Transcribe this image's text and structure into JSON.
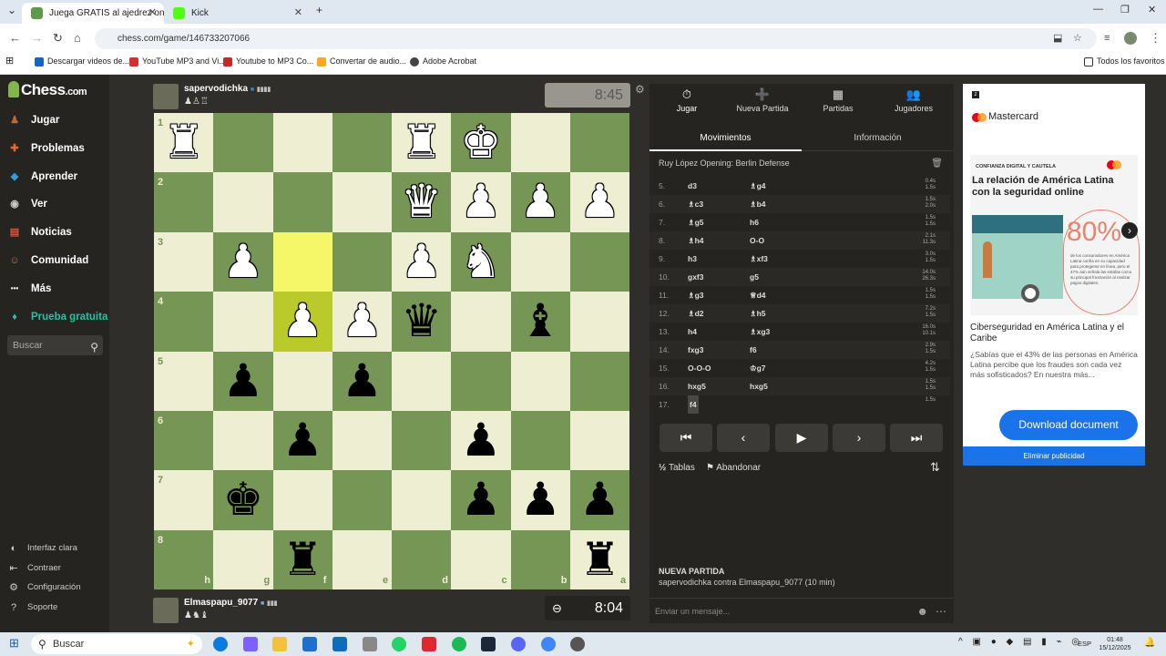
{
  "browser": {
    "tabs": [
      {
        "title": "Juega GRATIS al ajedrez online -",
        "favicon_color": "#5d9948"
      },
      {
        "title": "Kick",
        "favicon_color": "#53fc18"
      }
    ],
    "url": "chess.com/game/146733207066",
    "bookmarks": [
      {
        "label": "Descargar videos de...",
        "color": "#1565c0"
      },
      {
        "label": "YouTube MP3 and Vi...",
        "color": "#d32f2f"
      },
      {
        "label": "Youtube to MP3 Co...",
        "color": "#c62828"
      },
      {
        "label": "Convertar de audio...",
        "color": "#f9a825"
      },
      {
        "label": "Adobe Acrobat",
        "color": "#444444"
      }
    ],
    "all_bookmarks_label": "Todos los favoritos"
  },
  "sidebar": {
    "logo": "Chess",
    "logo_suffix": ".com",
    "items": [
      {
        "label": "Jugar",
        "icon": "play-icon",
        "color": "#ba6a37"
      },
      {
        "label": "Problemas",
        "icon": "puzzle-icon",
        "color": "#e9662c"
      },
      {
        "label": "Aprender",
        "icon": "learn-icon",
        "color": "#2f9ed4"
      },
      {
        "label": "Ver",
        "icon": "watch-icon",
        "color": "#c8c8c8"
      },
      {
        "label": "Noticias",
        "icon": "news-icon",
        "color": "#e6503b"
      },
      {
        "label": "Comunidad",
        "icon": "community-icon",
        "color": "#b07d5a"
      },
      {
        "label": "Más",
        "icon": "more-icon",
        "color": "#ffffff"
      },
      {
        "label": "Prueba gratuita",
        "icon": "diamond-icon",
        "color": "#26c2a3"
      }
    ],
    "search_placeholder": "Buscar",
    "footer": [
      {
        "label": "Interfaz clara",
        "icon": "theme-icon"
      },
      {
        "label": "Contraer",
        "icon": "collapse-icon"
      },
      {
        "label": "Configuración",
        "icon": "settings-icon"
      },
      {
        "label": "Soporte",
        "icon": "help-icon"
      }
    ]
  },
  "top_player": {
    "name": "sapervodichka",
    "clock": "8:45"
  },
  "bottom_player": {
    "name": "Elmaspapu_9077",
    "clock": "8:04"
  },
  "board": {
    "light": "#eeeed2",
    "dark": "#769656",
    "rank_labels": [
      "1",
      "2",
      "3",
      "4",
      "5",
      "6",
      "7",
      "8"
    ],
    "file_labels": [
      "h",
      "g",
      "f",
      "e",
      "d",
      "c",
      "b",
      "a"
    ],
    "highlighted": [
      "f3",
      "f4"
    ],
    "pieces": [
      {
        "sq": "h1",
        "glyph": "♜",
        "color": "w"
      },
      {
        "sq": "d1",
        "glyph": "♜",
        "color": "w"
      },
      {
        "sq": "c1",
        "glyph": "♚",
        "color": "w"
      },
      {
        "sq": "d2",
        "glyph": "♛",
        "color": "w"
      },
      {
        "sq": "c2",
        "glyph": "♟",
        "color": "w"
      },
      {
        "sq": "b2",
        "glyph": "♟",
        "color": "w"
      },
      {
        "sq": "a2",
        "glyph": "♟",
        "color": "w"
      },
      {
        "sq": "g3",
        "glyph": "♟",
        "color": "w"
      },
      {
        "sq": "d3",
        "glyph": "♟",
        "color": "w"
      },
      {
        "sq": "c3",
        "glyph": "♞",
        "color": "w"
      },
      {
        "sq": "f4",
        "glyph": "♟",
        "color": "w"
      },
      {
        "sq": "e4",
        "glyph": "♟",
        "color": "w"
      },
      {
        "sq": "d4",
        "glyph": "♛",
        "color": "b"
      },
      {
        "sq": "b4",
        "glyph": "♝",
        "color": "b"
      },
      {
        "sq": "g5",
        "glyph": "♟",
        "color": "b"
      },
      {
        "sq": "e5",
        "glyph": "♟",
        "color": "b"
      },
      {
        "sq": "f6",
        "glyph": "♟",
        "color": "b"
      },
      {
        "sq": "c6",
        "glyph": "♟",
        "color": "b"
      },
      {
        "sq": "g7",
        "glyph": "♚",
        "color": "b"
      },
      {
        "sq": "c7",
        "glyph": "♟",
        "color": "b"
      },
      {
        "sq": "b7",
        "glyph": "♟",
        "color": "b"
      },
      {
        "sq": "a7",
        "glyph": "♟",
        "color": "b"
      },
      {
        "sq": "f8",
        "glyph": "♜",
        "color": "b"
      },
      {
        "sq": "a8",
        "glyph": "♜",
        "color": "b"
      }
    ]
  },
  "panel": {
    "tabs": [
      {
        "label": "Jugar",
        "icon": "⏱"
      },
      {
        "label": "Nueva Partida",
        "icon": "➕"
      },
      {
        "label": "Partidas",
        "icon": "▦"
      },
      {
        "label": "Jugadores",
        "icon": "👥"
      }
    ],
    "subtabs": [
      "Movimientos",
      "Información"
    ],
    "opening": "Ruy López Opening: Berlin Defense",
    "moves": [
      {
        "n": "5.",
        "w": "d3",
        "b": "♗g4",
        "t1": "0.4s",
        "t2": "1.5s"
      },
      {
        "n": "6.",
        "w": "♗c3",
        "b": "♗b4",
        "t1": "1.5s",
        "t2": "2.0s"
      },
      {
        "n": "7.",
        "w": "♗g5",
        "b": "h6",
        "t1": "1.5s",
        "t2": "1.5s"
      },
      {
        "n": "8.",
        "w": "♗h4",
        "b": "O-O",
        "t1": "2.1s",
        "t2": "11.3s"
      },
      {
        "n": "9.",
        "w": "h3",
        "b": "♗xf3",
        "t1": "3.0s",
        "t2": "1.5s"
      },
      {
        "n": "10.",
        "w": "gxf3",
        "b": "g5",
        "t1": "14.0s",
        "t2": "26.3s"
      },
      {
        "n": "11.",
        "w": "♗g3",
        "b": "♕d4",
        "t1": "1.5s",
        "t2": "1.5s"
      },
      {
        "n": "12.",
        "w": "♗d2",
        "b": "♗h5",
        "t1": "7.2s",
        "t2": "1.5s"
      },
      {
        "n": "13.",
        "w": "h4",
        "b": "♗xg3",
        "t1": "16.0s",
        "t2": "10.1s"
      },
      {
        "n": "14.",
        "w": "fxg3",
        "b": "f6",
        "t1": "2.9s",
        "t2": "1.5s"
      },
      {
        "n": "15.",
        "w": "O-O-O",
        "b": "♔g7",
        "t1": "4.2s",
        "t2": "1.5s"
      },
      {
        "n": "16.",
        "w": "hxg5",
        "b": "hxg5",
        "t1": "1.5s",
        "t2": "1.5s"
      },
      {
        "n": "17.",
        "w": "f4",
        "b": "",
        "t1": "1.5s",
        "t2": ""
      }
    ],
    "draw_label": "Tablas",
    "resign_label": "Abandonar",
    "new_game_title": "NUEVA PARTIDA",
    "new_game_sub": "sapervodichka contra Elmaspapu_9077 (10 min)",
    "message_placeholder": "Enviar un mensaje..."
  },
  "ad": {
    "brand": "Mastercard",
    "tag": "CONFIANZA DIGITAL Y CAUTELA",
    "heading": "La relación de América Latina con la seguridad online",
    "stat": "80%",
    "stat_text": "de los consumidores en América Latina confía en su capacidad para protegerse en línea, pero el 47% aún señala las estafas como su principal frustración al realizar pagos digitales.",
    "headline": "Ciberseguridad en América Latina y el Caribe",
    "desc": "¿Sabías que el 43% de las personas en América Latina percibe que los fraudes son cada vez más sofisticados? En nuestra más...",
    "button": "Download document",
    "footer": "Eliminar publicidad"
  },
  "taskbar": {
    "search_label": "Buscar",
    "lang": "ESP",
    "time": "01:48",
    "date": "15/12/2025"
  }
}
